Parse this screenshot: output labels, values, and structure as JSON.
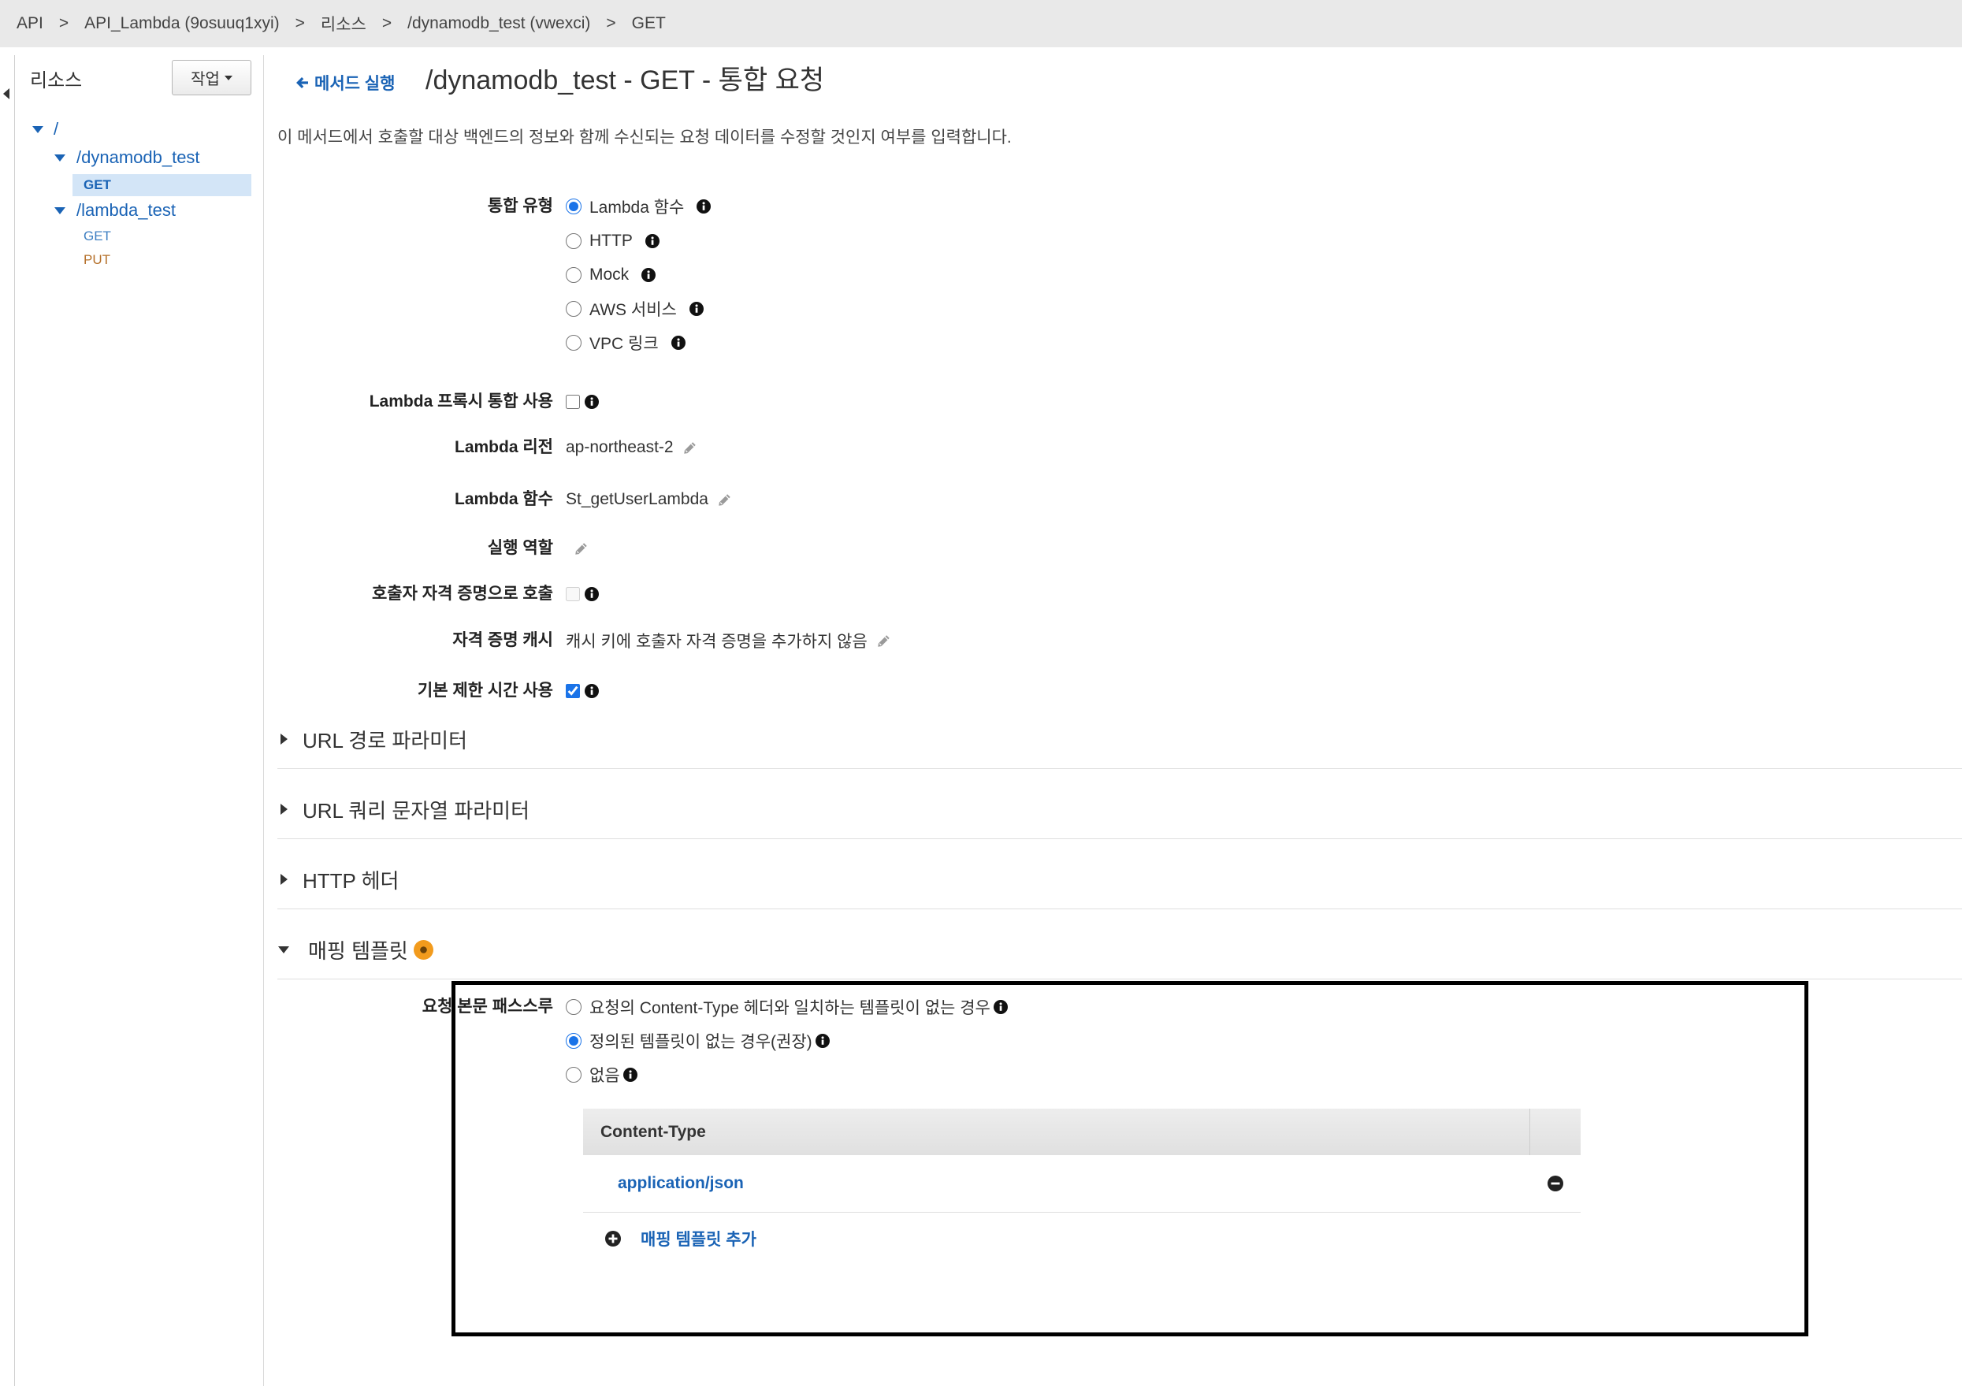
{
  "breadcrumb": {
    "separator": ">",
    "items": [
      "API",
      "API_Lambda (9osuuq1xyi)",
      "리소스",
      "/dynamodb_test (vwexci)",
      "GET"
    ]
  },
  "sidebar": {
    "collapse_icon": "caret-left-icon",
    "title": "리소스",
    "actions_button": {
      "label": "작업",
      "icon": "caret-down-icon"
    },
    "tree": {
      "label": "/",
      "expanded": true,
      "children": [
        {
          "label": "/dynamodb_test",
          "expanded": true,
          "methods": [
            {
              "label": "GET",
              "selected": true
            }
          ]
        },
        {
          "label": "/lambda_test",
          "expanded": true,
          "methods": [
            {
              "label": "GET",
              "selected": false
            },
            {
              "label": "PUT",
              "selected": false
            }
          ]
        }
      ]
    }
  },
  "header": {
    "back_icon": "arrow-left-icon",
    "back_link": "메서드 실행",
    "title": "/dynamodb_test - GET - 통합 요청",
    "description": "이 메서드에서 호출할 대상 백엔드의 정보와 함께 수신되는 요청 데이터를 수정할 것인지 여부를 입력합니다."
  },
  "form": {
    "integration_type": {
      "label": "통합 유형",
      "options": [
        {
          "label": "Lambda 함수",
          "selected": true
        },
        {
          "label": "HTTP",
          "selected": false
        },
        {
          "label": "Mock",
          "selected": false
        },
        {
          "label": "AWS 서비스",
          "selected": false
        },
        {
          "label": "VPC 링크",
          "selected": false
        }
      ]
    },
    "lambda_proxy": {
      "label": "Lambda 프록시 통합 사용",
      "checked": false
    },
    "lambda_region": {
      "label": "Lambda 리전",
      "value": "ap-northeast-2"
    },
    "lambda_function": {
      "label": "Lambda 함수",
      "value": "St_getUserLambda"
    },
    "execution_role": {
      "label": "실행 역할",
      "value": ""
    },
    "invoke_with_caller_credentials": {
      "label": "호출자 자격 증명으로 호출",
      "checked": false,
      "disabled": true
    },
    "credentials_cache": {
      "label": "자격 증명 캐시",
      "value": "캐시 키에 호출자 자격 증명을 추가하지 않음"
    },
    "default_timeout": {
      "label": "기본 제한 시간 사용",
      "checked": true
    }
  },
  "sections": [
    {
      "title": "URL 경로 파라미터",
      "expanded": false
    },
    {
      "title": "URL 쿼리 문자열 파라미터",
      "expanded": false
    },
    {
      "title": "HTTP 헤더",
      "expanded": false
    },
    {
      "title": "매핑 템플릿",
      "expanded": true,
      "status_icon": "warning-dot-icon"
    }
  ],
  "mapping_templates": {
    "passthrough": {
      "label": "요청 본문 패스스루",
      "options": [
        {
          "label": "요청의 Content-Type 헤더와 일치하는 템플릿이 없는 경우",
          "selected": false
        },
        {
          "label": "정의된 템플릿이 없는 경우(권장)",
          "selected": true
        },
        {
          "label": "없음",
          "selected": false
        }
      ]
    },
    "table": {
      "header": "Content-Type",
      "rows": [
        {
          "content_type": "application/json",
          "remove_icon": "minus-circle-icon"
        }
      ]
    },
    "add_button": {
      "label": "매핑 템플릿 추가",
      "icon": "plus-circle-icon"
    }
  },
  "icons": {
    "info": "info-icon",
    "edit": "pencil-icon",
    "section_collapsed": "caret-right-icon",
    "section_expanded": "caret-down-icon"
  },
  "colors": {
    "chrome_bg": "#e9e9e9",
    "link": "#1a63b5",
    "accent": "#1a73e8",
    "selected_bg": "#d3e5f7",
    "method_get": "#3f7fc2",
    "method_put": "#b5702a",
    "warning": "#f29b1d"
  }
}
